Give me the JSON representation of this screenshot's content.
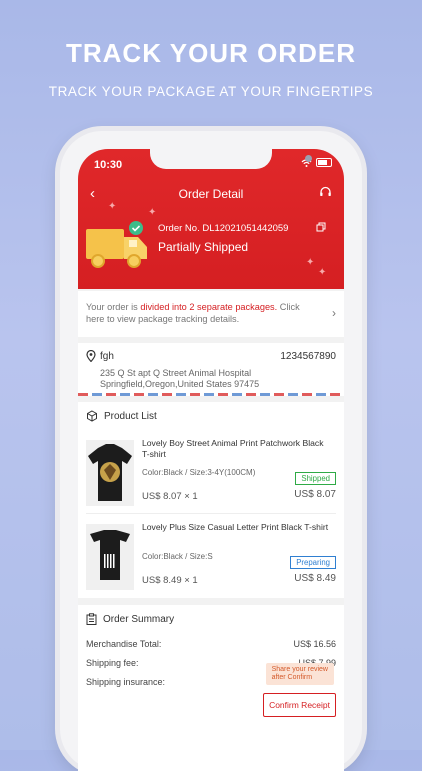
{
  "promo": {
    "title": "TRACK YOUR ORDER",
    "subtitle": "TRACK YOUR PACKAGE AT YOUR FINGERTIPS"
  },
  "status_bar": {
    "time": "10:30"
  },
  "header": {
    "title": "Order Detail",
    "order_no": "Order No. DL12021051442059",
    "status": "Partially Shipped"
  },
  "notice": {
    "prefix": "Your order is ",
    "highlight": "divided into 2 separate packages.",
    "suffix": " Click here to view package tracking details."
  },
  "address": {
    "name": "fgh",
    "phone": "1234567890",
    "line1": "235 Q St apt Q Street Animal Hospital",
    "line2": "Springfield,Oregon,United States   97475"
  },
  "products": {
    "section_title": "Product List",
    "items": [
      {
        "name": "Lovely Boy Street Animal Print Patchwork Black T-shirt",
        "attrs": "Color:Black / Size:3-4Y(100CM)",
        "status": "Shipped",
        "qty_price": "US$ 8.07 × 1",
        "total": "US$ 8.07"
      },
      {
        "name": "Lovely Plus Size Casual Letter Print Black T-shirt",
        "attrs": "Color:Black / Size:S",
        "status": "Preparing",
        "qty_price": "US$ 8.49 × 1",
        "total": "US$ 8.49"
      }
    ]
  },
  "summary": {
    "section_title": "Order Summary",
    "merchandise_label": "Merchandise Total:",
    "merchandise_value": "US$ 16.56",
    "shipping_label": "Shipping fee:",
    "shipping_value": "US$ 7.99",
    "insurance_label": "Shipping insurance:",
    "tooltip_line1": "Share your review",
    "tooltip_line2": "after Confirm",
    "confirm_label": "Confirm Receipt"
  },
  "colors": {
    "brand_red": "#d51f22",
    "shipped_green": "#2eaa45",
    "preparing_blue": "#2f7fd1"
  },
  "icons": [
    "back-arrow-icon",
    "headset-icon",
    "copy-icon",
    "truck-icon",
    "check-icon",
    "chevron-right-icon",
    "location-pin-icon",
    "package-icon",
    "clipboard-icon",
    "wifi-icon",
    "battery-icon"
  ]
}
